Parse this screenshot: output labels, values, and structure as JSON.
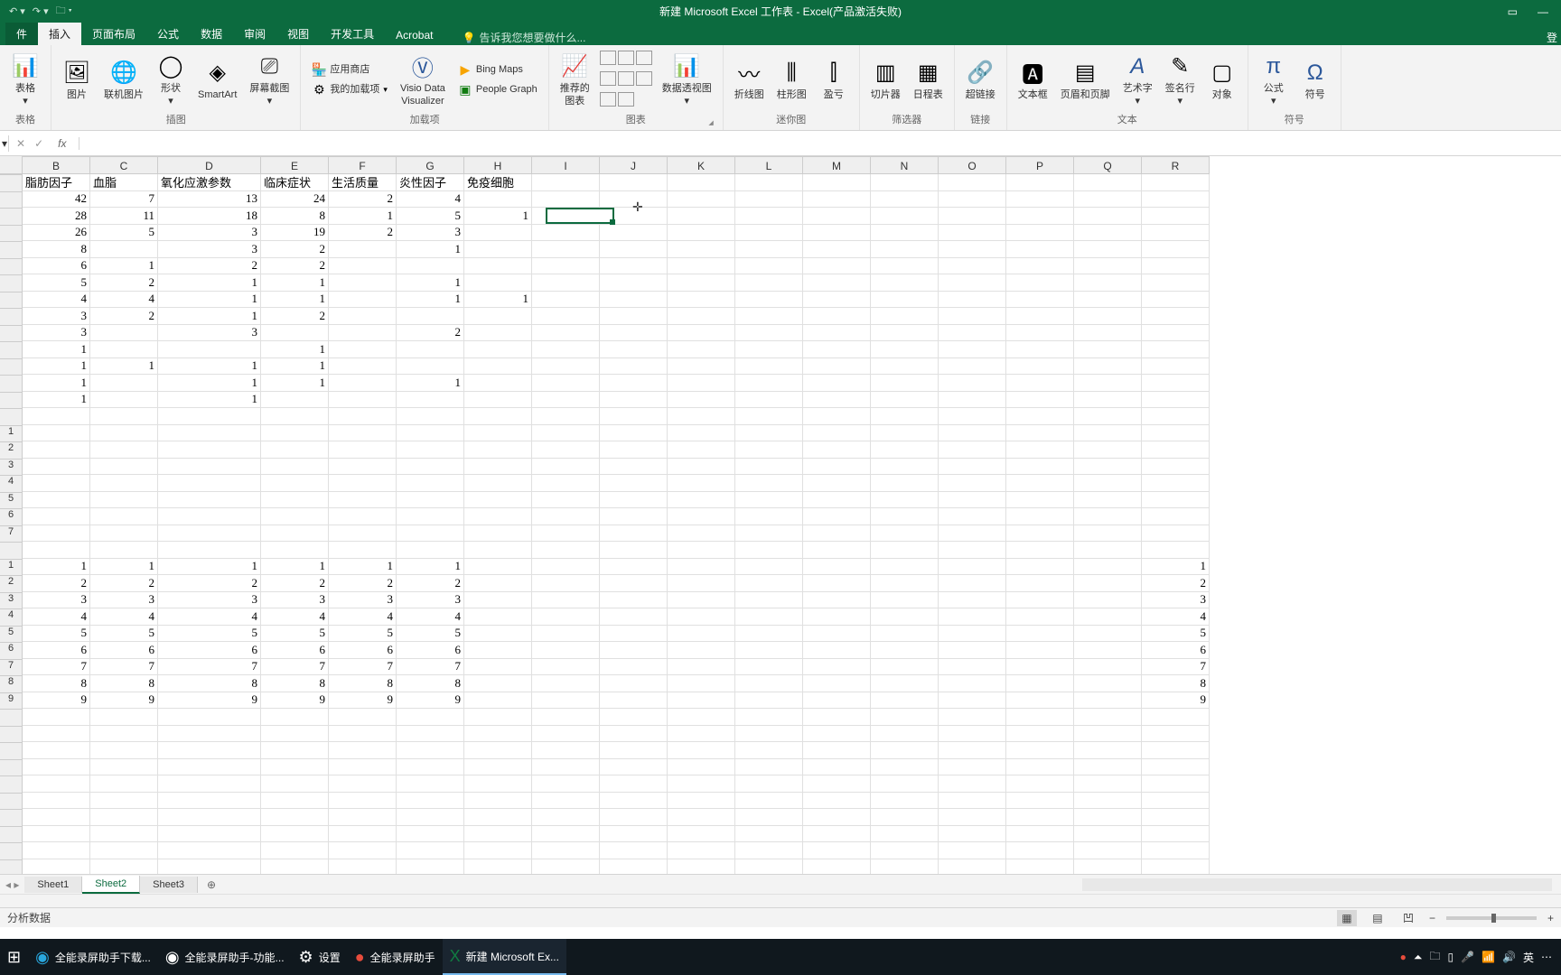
{
  "title": "新建 Microsoft Excel 工作表 - Excel(产品激活失败)",
  "login": "登",
  "tabs": [
    "插入",
    "页面布局",
    "公式",
    "数据",
    "审阅",
    "视图",
    "开发工具",
    "Acrobat"
  ],
  "tellme": "告诉我您想要做什么...",
  "ribbon": {
    "g0": {
      "label": "表格",
      "items": [
        "表格"
      ]
    },
    "g1": {
      "label": "插图",
      "items": [
        "图片",
        "联机图片",
        "形状",
        "SmartArt",
        "屏幕截图"
      ]
    },
    "g2": {
      "label": "加载项",
      "store": "应用商店",
      "my": "我的加载项",
      "visio_top": "Visio Data",
      "visio_bot": "Visualizer",
      "bing": "Bing Maps",
      "people": "People Graph"
    },
    "g3": {
      "label": "图表",
      "rec_top": "推荐的",
      "rec_bot": "图表",
      "pivot": "数据透视图"
    },
    "g4": {
      "label": "迷你图",
      "spark": [
        "折线图",
        "柱形图",
        "盈亏"
      ]
    },
    "g5": {
      "label": "筛选器",
      "items": [
        "切片器",
        "日程表"
      ]
    },
    "g6": {
      "label": "链接",
      "item": "超链接"
    },
    "g7": {
      "label": "文本",
      "items": [
        "文本框",
        "页眉和页脚",
        "艺术字",
        "签名行",
        "对象"
      ]
    },
    "g8": {
      "label": "符号",
      "items": [
        "公式",
        "符号"
      ]
    }
  },
  "columns": [
    "B",
    "C",
    "D",
    "E",
    "F",
    "G",
    "H",
    "I",
    "J",
    "K",
    "L",
    "M",
    "N",
    "O",
    "P",
    "Q",
    "R"
  ],
  "headers": [
    "脂肪因子",
    "血脂",
    "氧化应激参数",
    "临床症状",
    "生活质量",
    "炎性因子",
    "免疫细胞"
  ],
  "rows": [
    {
      "B": "42",
      "C": "7",
      "D": "13",
      "E": "24",
      "F": "2",
      "G": "4",
      "H": ""
    },
    {
      "B": "28",
      "C": "11",
      "D": "18",
      "E": "8",
      "F": "1",
      "G": "5",
      "H": "1"
    },
    {
      "B": "26",
      "C": "5",
      "D": "3",
      "E": "19",
      "F": "2",
      "G": "3",
      "H": ""
    },
    {
      "B": "8",
      "C": "",
      "D": "3",
      "E": "2",
      "F": "",
      "G": "1",
      "H": ""
    },
    {
      "B": "6",
      "C": "1",
      "D": "2",
      "E": "2",
      "F": "",
      "G": "",
      "H": ""
    },
    {
      "B": "5",
      "C": "2",
      "D": "1",
      "E": "1",
      "F": "",
      "G": "1",
      "H": ""
    },
    {
      "B": "4",
      "C": "4",
      "D": "1",
      "E": "1",
      "F": "",
      "G": "1",
      "H": "1"
    },
    {
      "B": "3",
      "C": "2",
      "D": "1",
      "E": "2",
      "F": "",
      "G": "",
      "H": ""
    },
    {
      "B": "3",
      "C": "",
      "D": "3",
      "E": "",
      "F": "",
      "G": "2",
      "H": ""
    },
    {
      "B": "1",
      "C": "",
      "D": "",
      "E": "1",
      "F": "",
      "G": "",
      "H": ""
    },
    {
      "B": "1",
      "C": "1",
      "D": "1",
      "E": "1",
      "F": "",
      "G": "",
      "H": ""
    },
    {
      "B": "1",
      "C": "",
      "D": "1",
      "E": "1",
      "F": "",
      "G": "1",
      "H": ""
    },
    {
      "B": "1",
      "C": "",
      "D": "1",
      "E": "",
      "F": "",
      "G": "",
      "H": ""
    }
  ],
  "rowhead_block1": [
    "1",
    "2",
    "3",
    "4",
    "5",
    "6",
    "7"
  ],
  "rows_block2": [
    {
      "R": "1",
      "B": "1",
      "C": "1",
      "D": "1",
      "E": "1",
      "F": "1",
      "G": "1"
    },
    {
      "R": "2",
      "B": "2",
      "C": "2",
      "D": "2",
      "E": "2",
      "F": "2",
      "G": "2"
    },
    {
      "R": "3",
      "B": "3",
      "C": "3",
      "D": "3",
      "E": "3",
      "F": "3",
      "G": "3"
    },
    {
      "R": "4",
      "B": "4",
      "C": "4",
      "D": "4",
      "E": "4",
      "F": "4",
      "G": "4"
    },
    {
      "R": "5",
      "B": "5",
      "C": "5",
      "D": "5",
      "E": "5",
      "F": "5",
      "G": "5"
    },
    {
      "R": "6",
      "B": "6",
      "C": "6",
      "D": "6",
      "E": "6",
      "F": "6",
      "G": "6"
    },
    {
      "R": "7",
      "B": "7",
      "C": "7",
      "D": "7",
      "E": "7",
      "F": "7",
      "G": "7"
    },
    {
      "R": "8",
      "B": "8",
      "C": "8",
      "D": "8",
      "E": "8",
      "F": "8",
      "G": "8"
    },
    {
      "R": "9",
      "B": "9",
      "C": "9",
      "D": "9",
      "E": "9",
      "F": "9",
      "G": "9"
    }
  ],
  "sheets": [
    "Sheet1",
    "Sheet2",
    "Sheet3"
  ],
  "status_left": "分析数据",
  "taskbar": {
    "items": [
      "全能录屏助手下载...",
      "全能录屏助手-功能...",
      "设置",
      "全能录屏助手",
      "新建 Microsoft Ex..."
    ],
    "tray_ime": "英"
  }
}
